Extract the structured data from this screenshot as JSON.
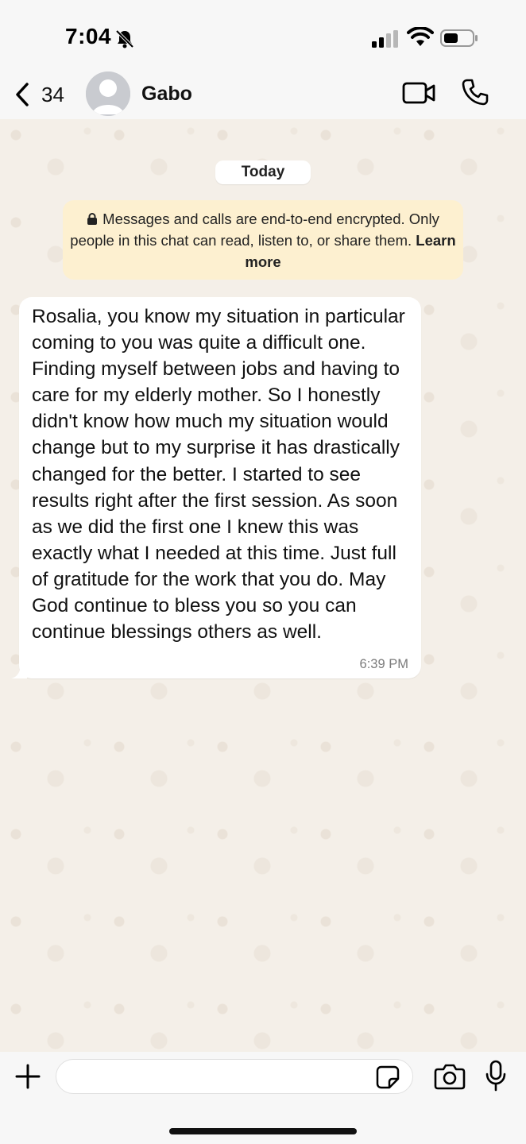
{
  "status_bar": {
    "time": "7:04"
  },
  "header": {
    "back_count": "34",
    "contact_name": "Gabo"
  },
  "chat": {
    "date_label": "Today",
    "encryption_notice": {
      "text": "Messages and calls are end-to-end encrypted. Only people in this chat can read, listen to, or share them.",
      "link": "Learn more"
    },
    "messages": [
      {
        "direction": "incoming",
        "text": "Rosalia, you know my situation in particular coming to you was quite a difficult one. Finding myself between jobs and having to care for my elderly mother. So I honestly didn't know how much my situation would change but to my surprise it has drastically changed for the better. I started to see results right after the first session. As soon as we did the first one I knew this was exactly what I needed at this time. Just full of gratitude for the work that you do. May God continue to bless you so you can continue blessings others as well.",
        "time": "6:39 PM"
      }
    ]
  },
  "composer": {
    "placeholder": ""
  },
  "colors": {
    "chat_background": "#f4efe8",
    "encryption_banner": "#fdf0d0",
    "bubble": "#ffffff"
  }
}
